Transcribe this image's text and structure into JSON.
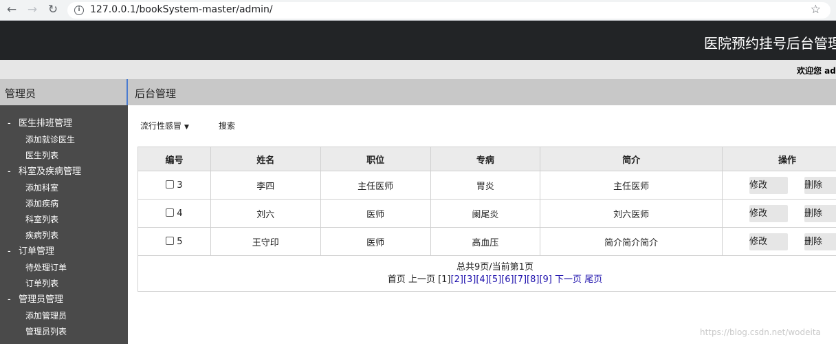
{
  "browser": {
    "url": "127.0.0.1/bookSystem-master/admin/"
  },
  "header": {
    "title": "医院预约挂号后台管理",
    "welcome": "欢迎您 admin"
  },
  "sidebar": {
    "title": "管理员",
    "groups": [
      {
        "label": "医生排班管理",
        "items": [
          "添加就诊医生",
          "医生列表"
        ]
      },
      {
        "label": "科室及疾病管理",
        "items": [
          "添加科室",
          "添加疾病",
          "科室列表",
          "疾病列表"
        ]
      },
      {
        "label": "订单管理",
        "items": [
          "待处理订单",
          "订单列表"
        ]
      },
      {
        "label": "管理员管理",
        "items": [
          "添加管理员",
          "管理员列表"
        ]
      }
    ]
  },
  "main": {
    "title": "后台管理",
    "filter": {
      "selected": "流行性感冒"
    },
    "search_label": "搜索",
    "table": {
      "headers": [
        "编号",
        "姓名",
        "职位",
        "专病",
        "简介",
        "操作"
      ],
      "rows": [
        {
          "id": "3",
          "name": "李四",
          "position": "主任医师",
          "disease": "胃炎",
          "intro": "主任医师"
        },
        {
          "id": "4",
          "name": "刘六",
          "position": "医师",
          "disease": "阑尾炎",
          "intro": "刘六医师"
        },
        {
          "id": "5",
          "name": "王守印",
          "position": "医师",
          "disease": "高血压",
          "intro": "简介简介简介"
        }
      ],
      "edit_label": "修改",
      "delete_label": "删除"
    },
    "pager": {
      "summary": "总共9页/当前第1页",
      "first": "首页",
      "prev": "上一页",
      "current": "[1]",
      "pages": [
        "[2]",
        "[3]",
        "[4]",
        "[5]",
        "[6]",
        "[7]",
        "[8]",
        "[9]"
      ],
      "next": "下一页",
      "last": "尾页"
    }
  },
  "watermark": "https://blog.csdn.net/wodeita"
}
